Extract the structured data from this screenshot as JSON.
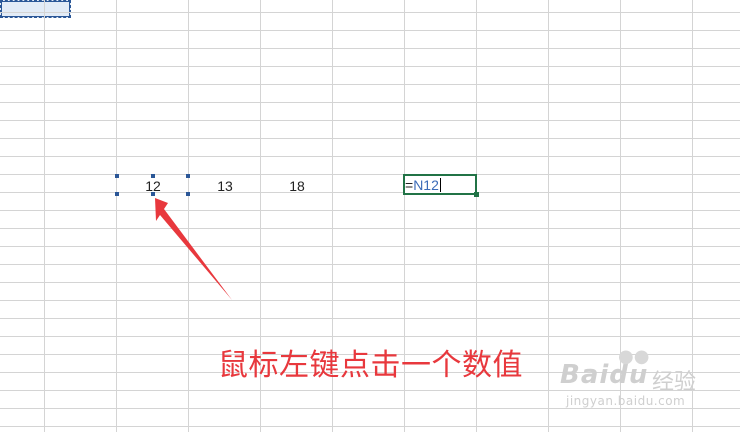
{
  "sheet": {
    "cells": {
      "selected_value": "12",
      "value_2": "13",
      "value_3": "18"
    },
    "edit_cell": {
      "equals": "=",
      "reference": "N12"
    }
  },
  "annotation": {
    "text": "鼠标左键点击一个数值",
    "color": "#e8383d"
  },
  "watermark": {
    "brand": "Baidu",
    "suffix": "经验",
    "url": "jingyan.baidu.com"
  },
  "colors": {
    "selection": "#2b5797",
    "edit_border": "#217346",
    "grid": "#d4d4d4"
  }
}
